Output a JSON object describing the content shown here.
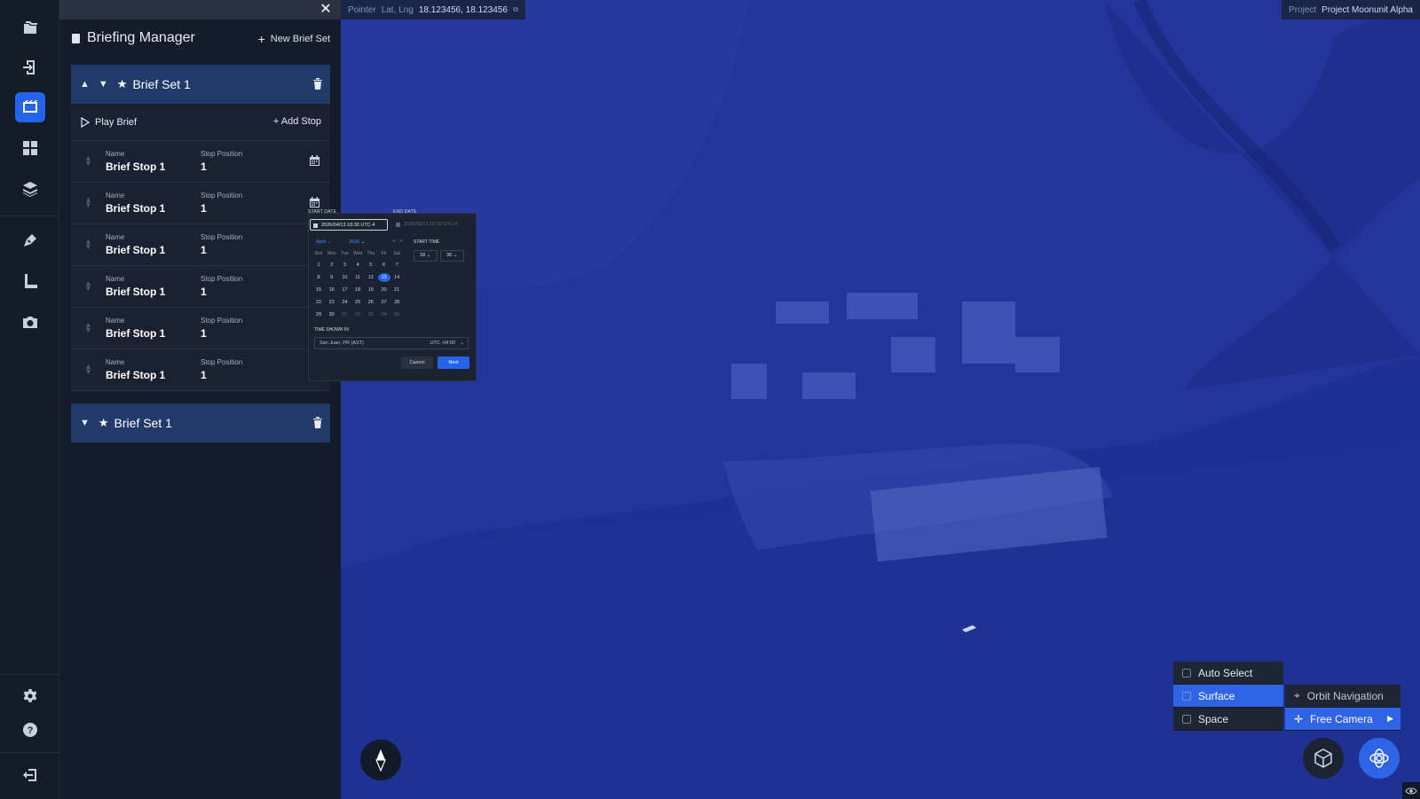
{
  "rail": {
    "top_icons": [
      "folders-icon",
      "import-icon",
      "briefing-icon",
      "dashboard-icon",
      "layers-icon"
    ],
    "mid_icons": [
      "pen-tool-icon",
      "measure-icon",
      "camera-icon"
    ],
    "bottom_icons": [
      "settings-icon",
      "help-icon",
      "logout-icon"
    ],
    "active": "briefing-icon"
  },
  "panel": {
    "title": "Briefing Manager",
    "new_label": "New Brief Set",
    "close": "✕"
  },
  "sets": [
    {
      "name": "Brief Set 1",
      "expanded": true,
      "play_label": "Play Brief",
      "add_label": "Add Stop",
      "stops": [
        {
          "k1": "Name",
          "v1": "Brief Stop 1",
          "k2": "Stop Position",
          "v2": "1"
        },
        {
          "k1": "Name",
          "v1": "Brief Stop 1",
          "k2": "Stop Position",
          "v2": "1"
        },
        {
          "k1": "Name",
          "v1": "Brief Stop 1",
          "k2": "Stop Position",
          "v2": "1"
        },
        {
          "k1": "Name",
          "v1": "Brief Stop 1",
          "k2": "Stop Position",
          "v2": "1"
        },
        {
          "k1": "Name",
          "v1": "Brief Stop 1",
          "k2": "Stop Position",
          "v2": "1"
        },
        {
          "k1": "Name",
          "v1": "Brief Stop 1",
          "k2": "Stop Position",
          "v2": "1"
        }
      ]
    },
    {
      "name": "Brief Set 1",
      "expanded": false
    }
  ],
  "pointer": {
    "label": "Pointer",
    "latlng_label": "Lat, Lng",
    "latlng": "18.123456, 18.123456"
  },
  "project": {
    "label": "Project",
    "name": "Project Moonunit Alpha"
  },
  "datepicker": {
    "start_label": "START DATE",
    "end_label": "END DATE",
    "start_value": "2026/04/13  18:30  UTC-4",
    "end_value": "2026/05/13  18:30  UTC-4",
    "month": "April",
    "year": "2026",
    "start_time_label": "START TIME",
    "hour": "18",
    "minute": "30",
    "dow": [
      "Sun",
      "Mon",
      "Tue",
      "Wed",
      "Thu",
      "Fri",
      "Sat"
    ],
    "weeks": [
      [
        "1",
        "2",
        "3",
        "4",
        "5",
        "6",
        "7"
      ],
      [
        "8",
        "9",
        "10",
        "11",
        "12",
        "13",
        "14"
      ],
      [
        "15",
        "16",
        "17",
        "18",
        "19",
        "20",
        "21"
      ],
      [
        "22",
        "23",
        "24",
        "25",
        "26",
        "27",
        "28"
      ],
      [
        "29",
        "30",
        "01",
        "02",
        "03",
        "04",
        "05"
      ]
    ],
    "selected": "13",
    "tz_label": "TIME SHOWN IN",
    "tz_value": "San Juan, PR (AST)",
    "tz_offset": "UTC -04:00",
    "cancel": "Cancel",
    "next": "Next"
  },
  "modes": [
    {
      "label": "Auto Select",
      "active": false
    },
    {
      "label": "Surface",
      "active": true
    },
    {
      "label": "Space",
      "active": false
    }
  ],
  "nav_modes": [
    {
      "label": "Orbit Navigation",
      "active": false
    },
    {
      "label": "Free Camera",
      "active": true
    }
  ],
  "colors": {
    "accent": "#2563eb",
    "map_tint": "#1d2f8c"
  }
}
